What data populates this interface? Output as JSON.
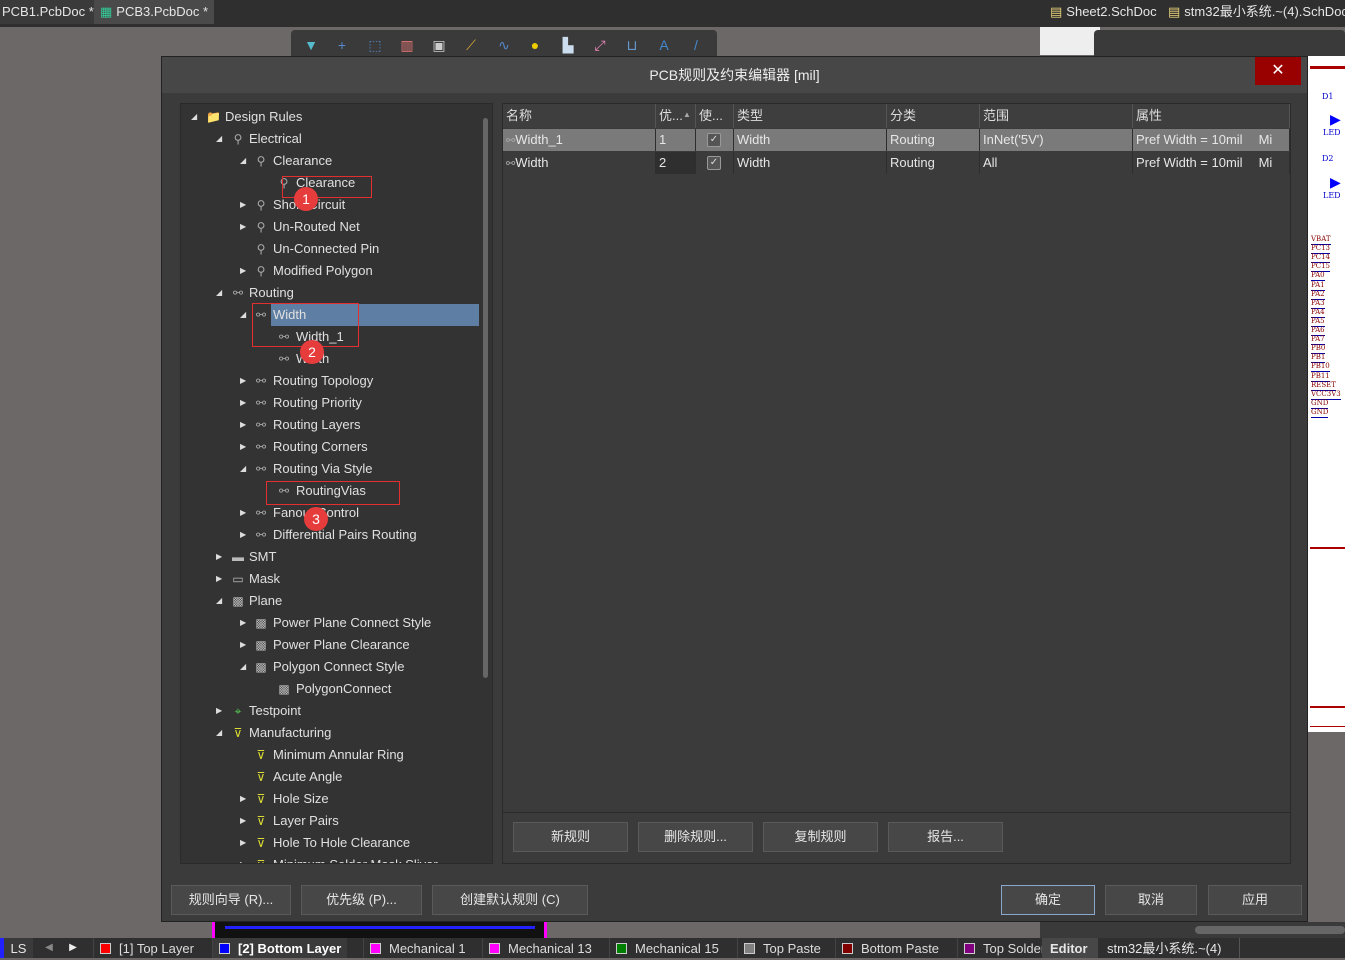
{
  "doc_tabs": {
    "left": [
      "PCB1.PcbDoc *",
      "PCB3.PcbDoc *"
    ],
    "right": [
      "Sheet2.SchDoc",
      "stm32最小系统.~(4).SchDoc"
    ]
  },
  "dialog": {
    "title": "PCB规则及约束编辑器 [mil]",
    "close_icon": "close-icon"
  },
  "tree": [
    {
      "label": "Design Rules",
      "level": 0,
      "arrow": "open",
      "icon": "folder"
    },
    {
      "label": "Electrical",
      "level": 1,
      "arrow": "open",
      "icon": "electrical"
    },
    {
      "label": "Clearance",
      "level": 2,
      "arrow": "open",
      "icon": "electrical"
    },
    {
      "label": "Clearance",
      "level": 3,
      "arrow": "",
      "icon": "electrical"
    },
    {
      "label": "Short-Circuit",
      "level": 2,
      "arrow": "closed",
      "icon": "electrical"
    },
    {
      "label": "Un-Routed Net",
      "level": 2,
      "arrow": "closed",
      "icon": "electrical"
    },
    {
      "label": "Un-Connected Pin",
      "level": 2,
      "arrow": "",
      "icon": "electrical"
    },
    {
      "label": "Modified Polygon",
      "level": 2,
      "arrow": "closed",
      "icon": "electrical"
    },
    {
      "label": "Routing",
      "level": 1,
      "arrow": "open",
      "icon": "routing"
    },
    {
      "label": "Width",
      "level": 2,
      "arrow": "open",
      "icon": "routing",
      "selected": true
    },
    {
      "label": "Width_1",
      "level": 3,
      "arrow": "",
      "icon": "routing"
    },
    {
      "label": "Width",
      "level": 3,
      "arrow": "",
      "icon": "routing"
    },
    {
      "label": "Routing Topology",
      "level": 2,
      "arrow": "closed",
      "icon": "routing"
    },
    {
      "label": "Routing Priority",
      "level": 2,
      "arrow": "closed",
      "icon": "routing"
    },
    {
      "label": "Routing Layers",
      "level": 2,
      "arrow": "closed",
      "icon": "routing"
    },
    {
      "label": "Routing Corners",
      "level": 2,
      "arrow": "closed",
      "icon": "routing"
    },
    {
      "label": "Routing Via Style",
      "level": 2,
      "arrow": "open",
      "icon": "routing"
    },
    {
      "label": "RoutingVias",
      "level": 3,
      "arrow": "",
      "icon": "routing"
    },
    {
      "label": "Fanout Control",
      "level": 2,
      "arrow": "closed",
      "icon": "routing"
    },
    {
      "label": "Differential Pairs Routing",
      "level": 2,
      "arrow": "closed",
      "icon": "routing"
    },
    {
      "label": "SMT",
      "level": 1,
      "arrow": "closed",
      "icon": "smt"
    },
    {
      "label": "Mask",
      "level": 1,
      "arrow": "closed",
      "icon": "mask"
    },
    {
      "label": "Plane",
      "level": 1,
      "arrow": "open",
      "icon": "plane"
    },
    {
      "label": "Power Plane Connect Style",
      "level": 2,
      "arrow": "closed",
      "icon": "plane"
    },
    {
      "label": "Power Plane Clearance",
      "level": 2,
      "arrow": "closed",
      "icon": "plane"
    },
    {
      "label": "Polygon Connect Style",
      "level": 2,
      "arrow": "open",
      "icon": "plane"
    },
    {
      "label": "PolygonConnect",
      "level": 3,
      "arrow": "",
      "icon": "plane"
    },
    {
      "label": "Testpoint",
      "level": 1,
      "arrow": "closed",
      "icon": "testpoint"
    },
    {
      "label": "Manufacturing",
      "level": 1,
      "arrow": "open",
      "icon": "manufacturing"
    },
    {
      "label": "Minimum Annular Ring",
      "level": 2,
      "arrow": "",
      "icon": "manufacturing"
    },
    {
      "label": "Acute Angle",
      "level": 2,
      "arrow": "",
      "icon": "manufacturing"
    },
    {
      "label": "Hole Size",
      "level": 2,
      "arrow": "closed",
      "icon": "manufacturing"
    },
    {
      "label": "Layer Pairs",
      "level": 2,
      "arrow": "closed",
      "icon": "manufacturing"
    },
    {
      "label": "Hole To Hole Clearance",
      "level": 2,
      "arrow": "closed",
      "icon": "manufacturing"
    },
    {
      "label": "Minimum Solder Mask Sliver",
      "level": 2,
      "arrow": "closed",
      "icon": "manufacturing"
    }
  ],
  "grid": {
    "columns": [
      "名称",
      "优...",
      "使...",
      "类型",
      "分类",
      "范围",
      "属性"
    ],
    "rows": [
      {
        "name": "Width_1",
        "priority": "1",
        "enabled": true,
        "type": "Width",
        "category": "Routing",
        "scope": "InNet('5V')",
        "attributes": "Pref Width = 10mil",
        "more": "Mi",
        "selected": true
      },
      {
        "name": "Width",
        "priority": "2",
        "enabled": true,
        "type": "Width",
        "category": "Routing",
        "scope": "All",
        "attributes": "Pref Width = 10mil",
        "more": "Mi"
      }
    ],
    "buttons": [
      "新规则",
      "删除规则...",
      "复制规则",
      "报告..."
    ]
  },
  "footer_buttons": {
    "wizard": "规则向导 (R)...",
    "priority": "优先级 (P)...",
    "create_default": "创建默认规则 (C)",
    "ok": "确定",
    "cancel": "取消",
    "apply": "应用"
  },
  "annotations": [
    "1",
    "2",
    "3"
  ],
  "schematic": {
    "parts": [
      "D1",
      "LED",
      "D2",
      "LED"
    ],
    "pins": [
      "VBAT",
      "PC13",
      "PC14",
      "PC15",
      "PA0",
      "PA1",
      "PA2",
      "PA3",
      "PA4",
      "PA5",
      "PA6",
      "PA7",
      "PB0",
      "PB1",
      "PB10",
      "PB11",
      "RESET",
      "VCC3V3",
      "GND",
      "GND"
    ]
  },
  "statusbar": {
    "ls": "LS",
    "layers": [
      {
        "name": "[1] Top Layer",
        "color": "#ff0000"
      },
      {
        "name": "[2] Bottom Layer",
        "color": "#0000ff",
        "active": true
      },
      {
        "name": "Mechanical 1",
        "color": "#ff00ff"
      },
      {
        "name": "Mechanical 13",
        "color": "#ff00ff"
      },
      {
        "name": "Mechanical 15",
        "color": "#008000"
      },
      {
        "name": "Top Paste",
        "color": "#808080"
      },
      {
        "name": "Bottom Paste",
        "color": "#800000"
      },
      {
        "name": "Top Solder",
        "color": "#800080"
      }
    ],
    "panels": [
      "Editor",
      "stm32最小系统.~(4)"
    ]
  }
}
